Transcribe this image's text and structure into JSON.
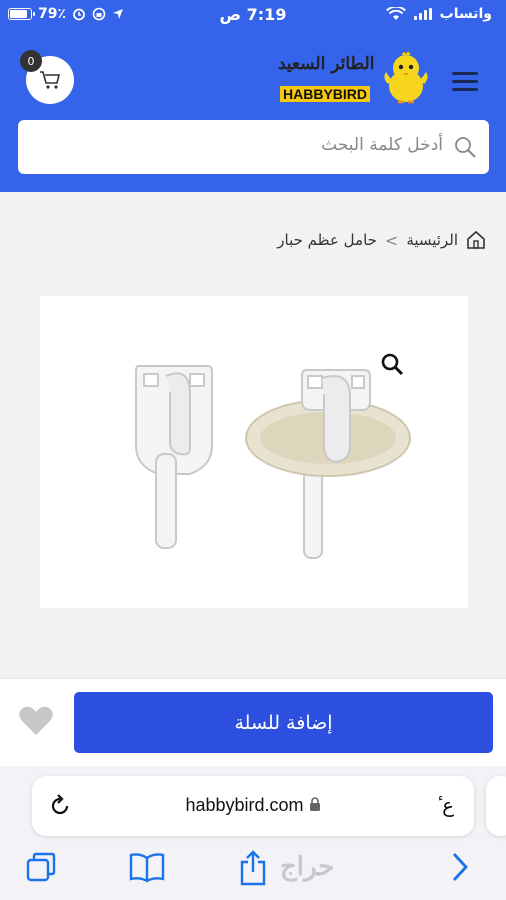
{
  "status_bar": {
    "carrier": "واتساب",
    "time": "7:19 ص",
    "battery": "79٪",
    "battery_level": 0.79
  },
  "header": {
    "cart_count": "0",
    "logo_ar": "الطائر السعيد",
    "logo_en": "HABBYBIRD",
    "search_placeholder": "أدخل كلمة البحث"
  },
  "breadcrumb": {
    "home": "الرئيسية",
    "separator": ">",
    "current": "حامل عظم حبار"
  },
  "product": {
    "add_to_cart": "إضافة للسلة"
  },
  "browser": {
    "text_size": "ٔ ع",
    "url": "habbybird.com"
  },
  "watermark": "حراج",
  "colors": {
    "brand_blue": "#3563e9",
    "button_blue": "#2d4fe0",
    "ios_blue": "#1a73e8"
  }
}
